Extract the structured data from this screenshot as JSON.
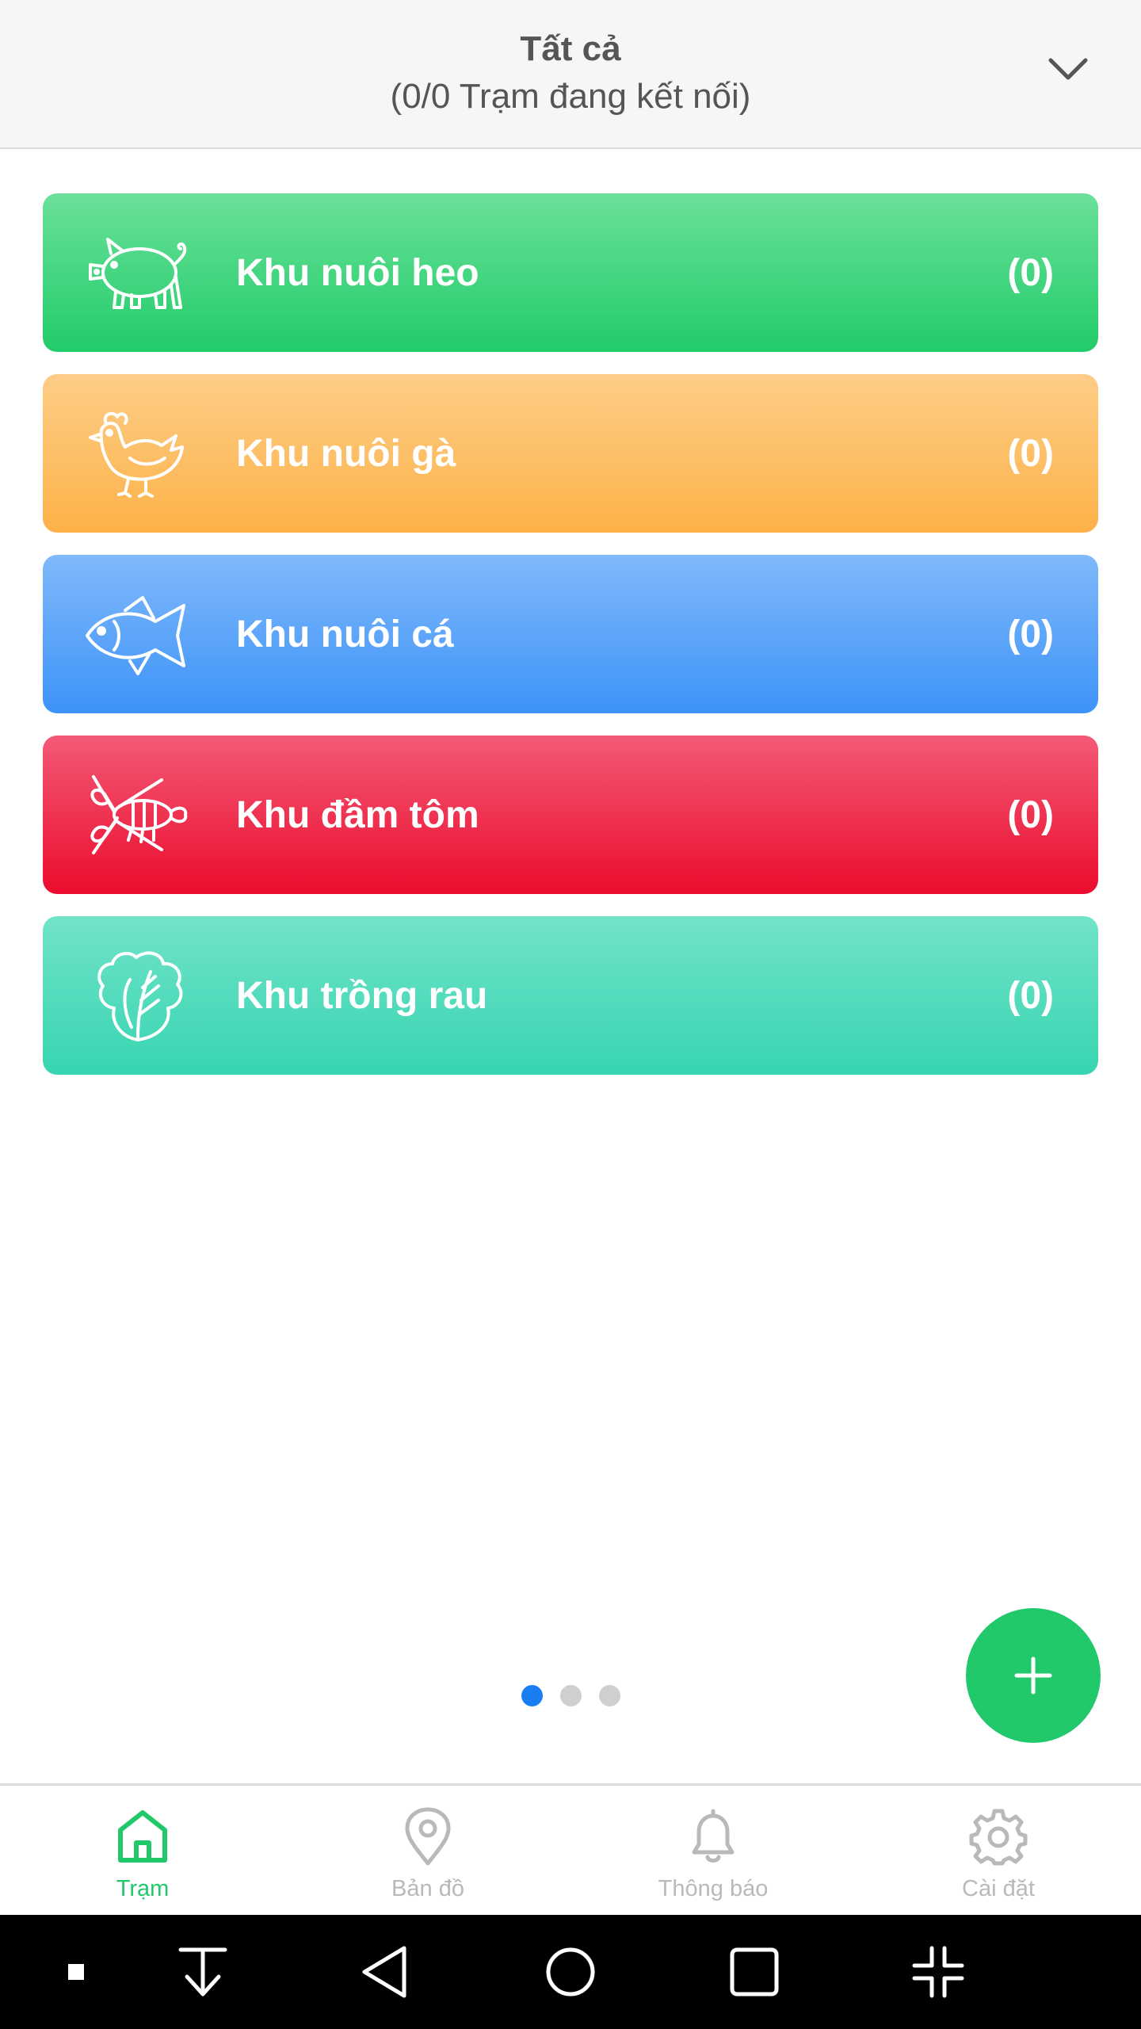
{
  "header": {
    "title": "Tất cả",
    "subtitle": "(0/0 Trạm đang kết nối)",
    "dropdown_icon": "chevron-down-icon"
  },
  "zones": [
    {
      "name": "Khu nuôi heo",
      "count": "(0)",
      "icon": "pig-icon",
      "color_top": "#6be09a",
      "color_bottom": "#22cc6a"
    },
    {
      "name": "Khu nuôi gà",
      "count": "(0)",
      "icon": "chicken-icon",
      "color_top": "#fdcd88",
      "color_bottom": "#fdb248"
    },
    {
      "name": "Khu nuôi cá",
      "count": "(0)",
      "icon": "fish-icon",
      "color_top": "#80b9fb",
      "color_bottom": "#3d93f8"
    },
    {
      "name": "Khu đầm tôm",
      "count": "(0)",
      "icon": "shrimp-icon",
      "color_top": "#f25a77",
      "color_bottom": "#ec0c2d"
    },
    {
      "name": "Khu trồng rau",
      "count": "(0)",
      "icon": "vegetable-icon",
      "color_top": "#72e3c9",
      "color_bottom": "#37d5b1"
    }
  ],
  "pager": {
    "pages": 3,
    "current": 1
  },
  "fab": {
    "icon": "plus-icon",
    "color": "#21c96b"
  },
  "tabs": [
    {
      "label": "Trạm",
      "icon": "home-icon",
      "active": true
    },
    {
      "label": "Bản đồ",
      "icon": "map-pin-icon",
      "active": false
    },
    {
      "label": "Thông báo",
      "icon": "bell-icon",
      "active": false
    },
    {
      "label": "Cài đặt",
      "icon": "gear-icon",
      "active": false
    }
  ],
  "colors": {
    "accent": "#21c96b",
    "inactive": "#b9b9b9",
    "pager_active": "#1a7ef3"
  }
}
